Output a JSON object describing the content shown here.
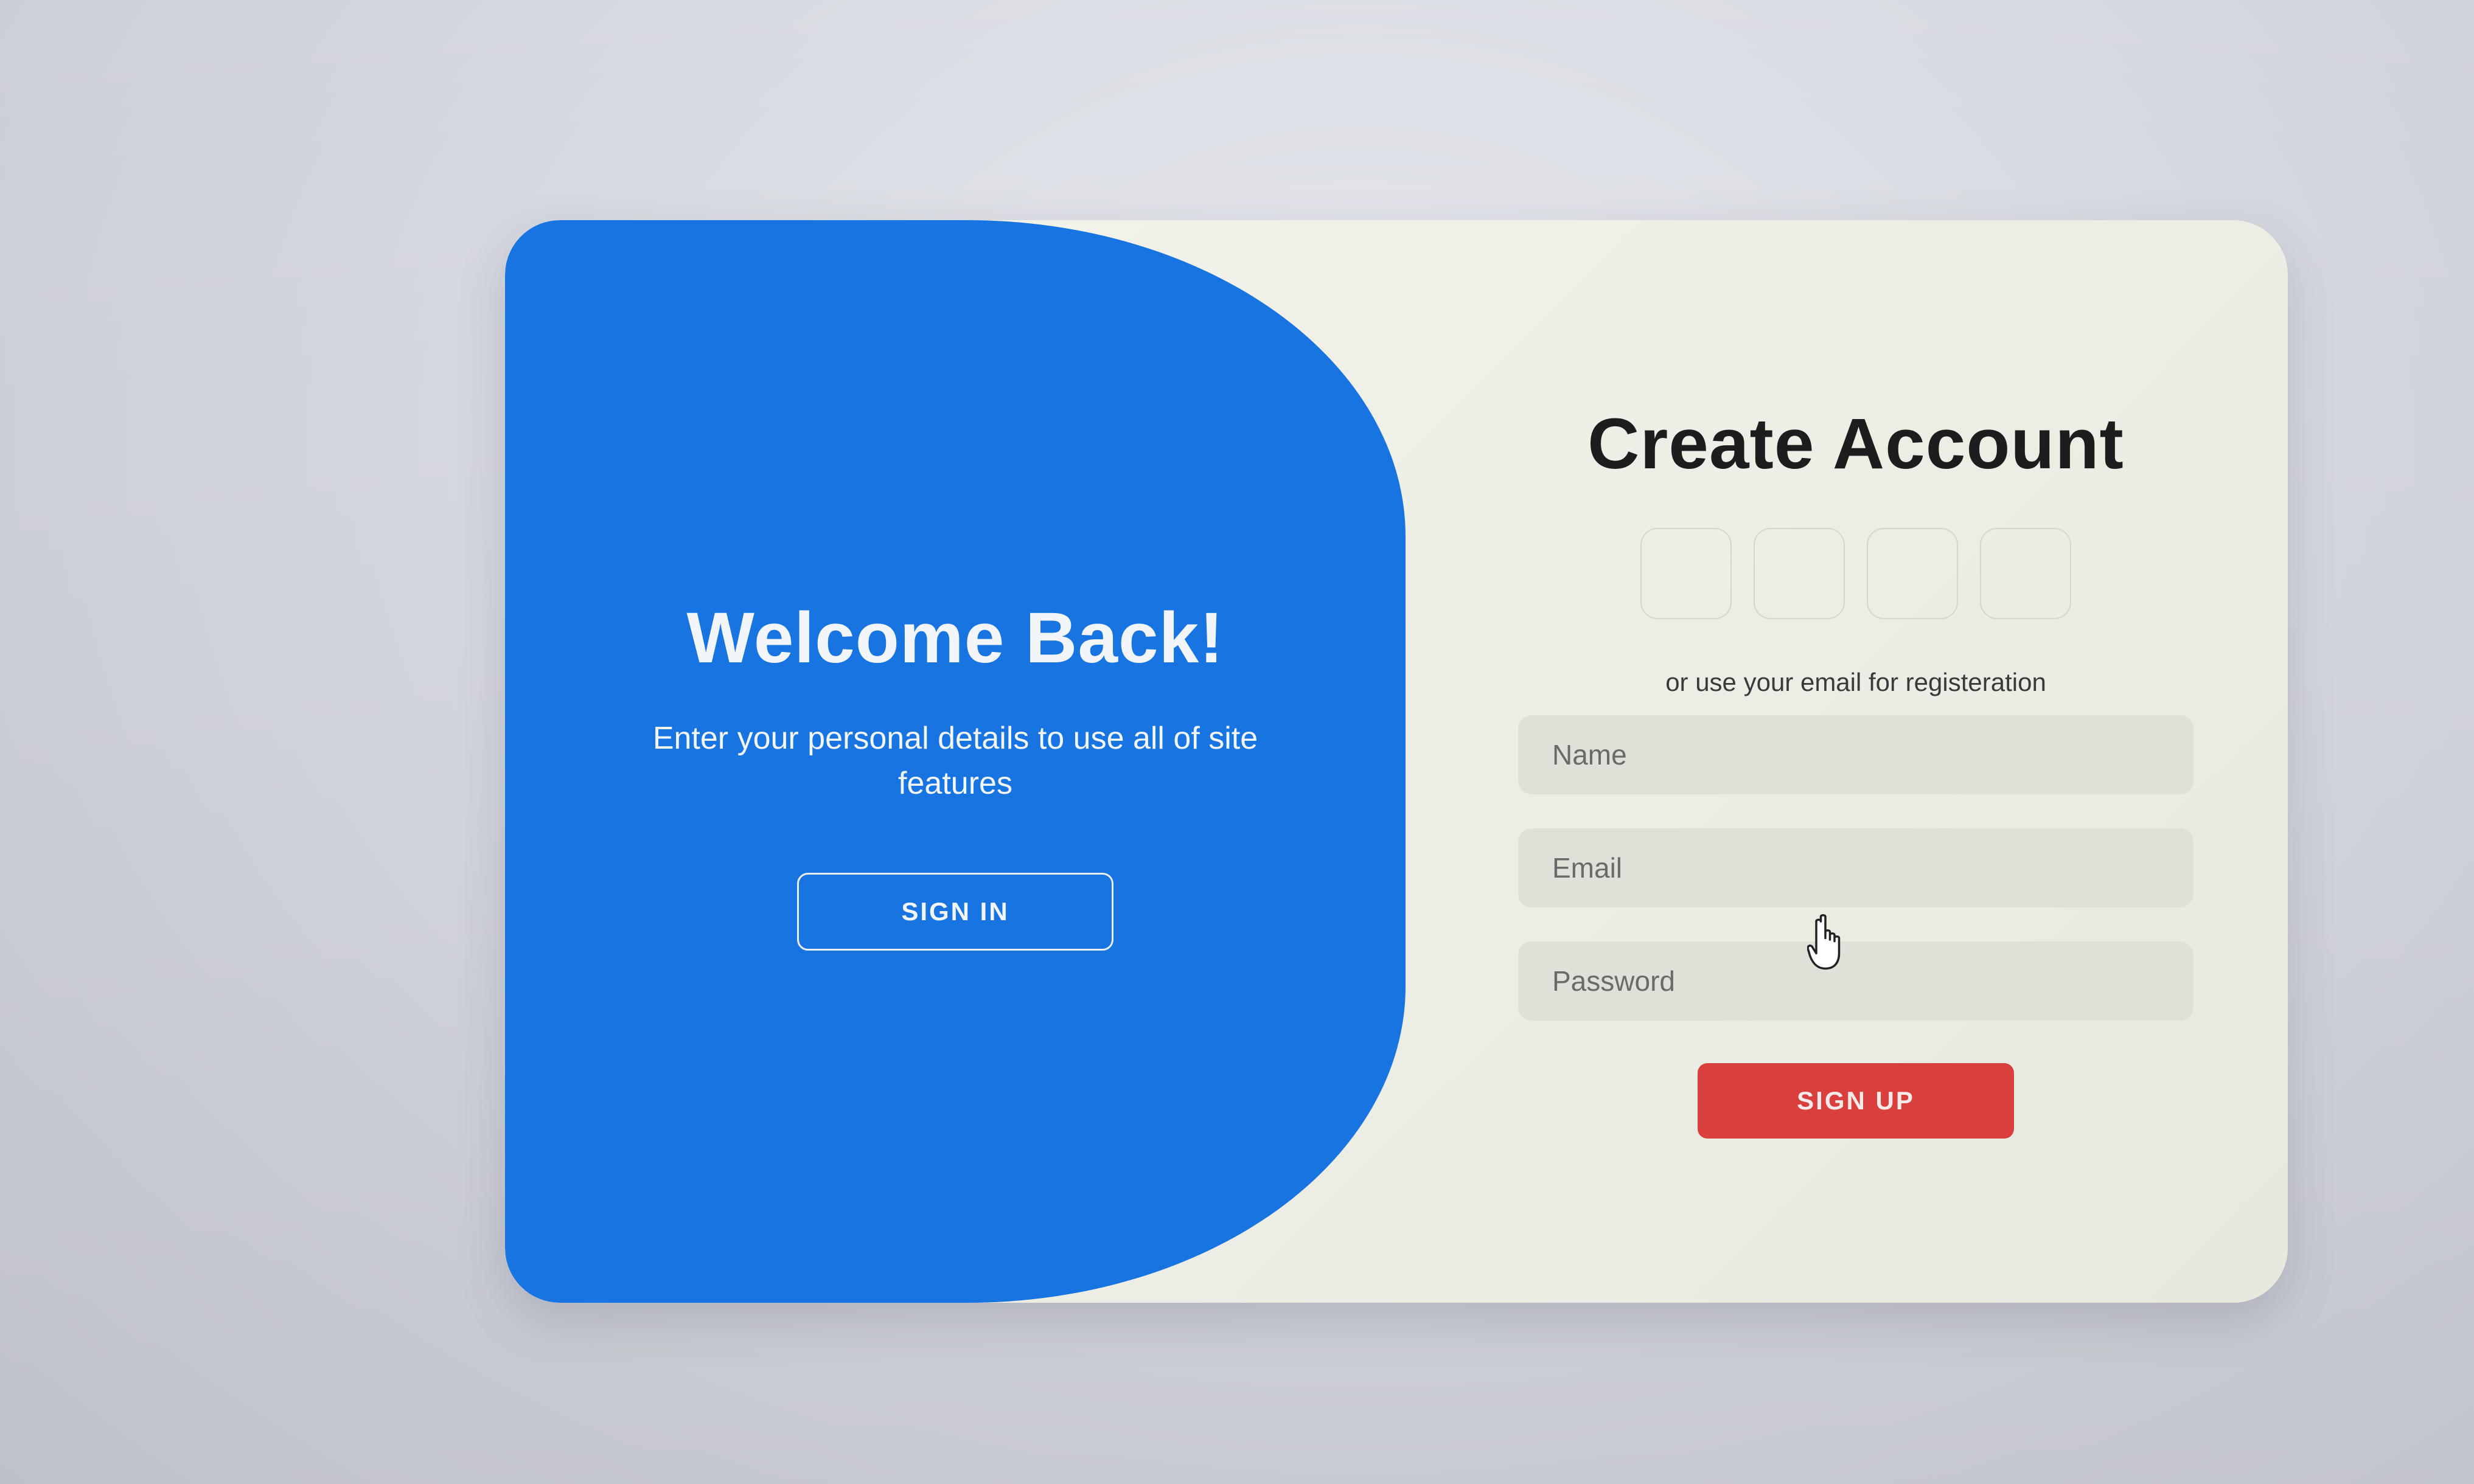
{
  "welcome": {
    "title": "Welcome Back!",
    "text": "Enter your personal details to use all of site features",
    "signin_label": "SIGN IN"
  },
  "signup": {
    "title": "Create Account",
    "social_icons": [
      "social-icon-1",
      "social-icon-2",
      "social-icon-3",
      "social-icon-4"
    ],
    "subtitle": "or use your email for registeration",
    "fields": {
      "name_placeholder": "Name",
      "email_placeholder": "Email",
      "password_placeholder": "Password"
    },
    "signup_label": "SIGN UP"
  },
  "colors": {
    "panel_blue": "#1874e0",
    "signup_red": "#d9403d",
    "card_bg": "#f4f4ec"
  },
  "cursor": "hand-pointer-icon"
}
